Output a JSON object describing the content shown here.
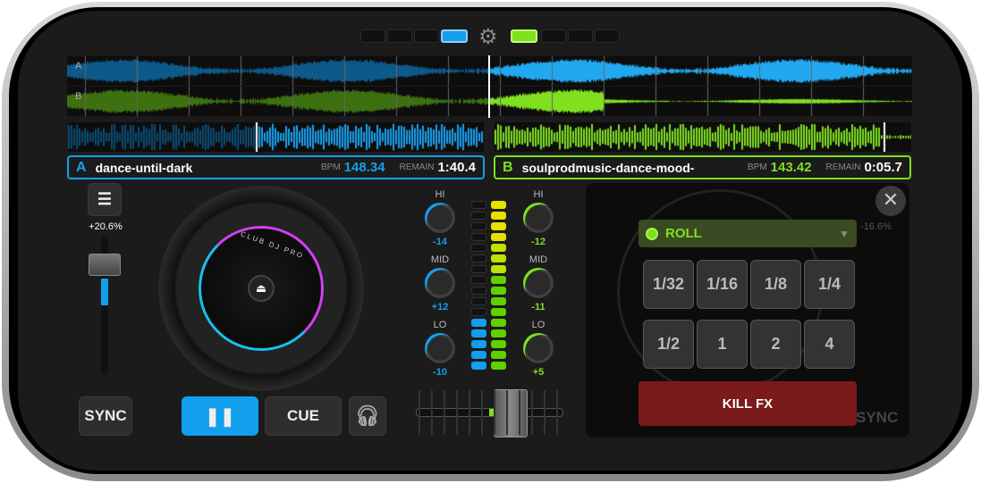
{
  "colors": {
    "deck_a": "#12a0ee",
    "deck_b": "#7fe01c",
    "kill": "#7a1a1a"
  },
  "deck_a": {
    "letter": "A",
    "title": "dance-until-dark",
    "bpm_label": "BPM",
    "bpm": "148.34",
    "remain_label": "REMAIN",
    "remain": "1:40.4",
    "pitch": "+20.6%",
    "pitch_level": 0.6,
    "sync": "SYNC",
    "cue": "CUE",
    "play_icon": "pause-icon",
    "brand": "CLUB DJ PRO",
    "eq": [
      {
        "label": "HI",
        "value": "-14"
      },
      {
        "label": "MID",
        "value": "+12"
      },
      {
        "label": "LO",
        "value": "-10"
      }
    ]
  },
  "deck_b": {
    "letter": "B",
    "title": "soulprodmusic-dance-mood-",
    "bpm_label": "BPM",
    "bpm": "143.42",
    "remain_label": "REMAIN",
    "remain": "0:05.7",
    "pitch": "-16.6%",
    "sync": "SYNC",
    "eq": [
      {
        "label": "HI",
        "value": "-12"
      },
      {
        "label": "MID",
        "value": "-11"
      },
      {
        "label": "LO",
        "value": "+5"
      }
    ]
  },
  "overview": {
    "a_label": "A",
    "b_label": "B"
  },
  "crossfader": {
    "position": 0.7
  },
  "vu": {
    "a_level": 5,
    "b_level": 16,
    "segments": 16
  },
  "fx": {
    "effect": "ROLL",
    "buttons": [
      "1/32",
      "1/16",
      "1/8",
      "1/4",
      "1/2",
      "1",
      "2",
      "4"
    ],
    "kill": "KILL FX"
  }
}
